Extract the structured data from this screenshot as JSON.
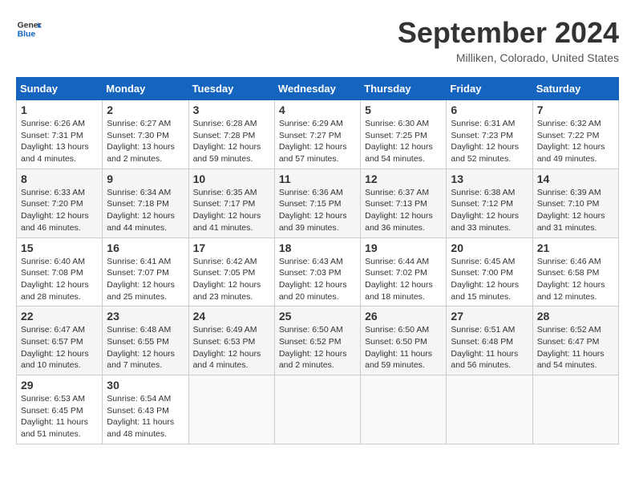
{
  "header": {
    "logo_line1": "General",
    "logo_line2": "Blue",
    "month_title": "September 2024",
    "location": "Milliken, Colorado, United States"
  },
  "weekdays": [
    "Sunday",
    "Monday",
    "Tuesday",
    "Wednesday",
    "Thursday",
    "Friday",
    "Saturday"
  ],
  "weeks": [
    [
      {
        "day": "1",
        "sunrise": "6:26 AM",
        "sunset": "7:31 PM",
        "daylight": "13 hours and 4 minutes"
      },
      {
        "day": "2",
        "sunrise": "6:27 AM",
        "sunset": "7:30 PM",
        "daylight": "13 hours and 2 minutes"
      },
      {
        "day": "3",
        "sunrise": "6:28 AM",
        "sunset": "7:28 PM",
        "daylight": "12 hours and 59 minutes"
      },
      {
        "day": "4",
        "sunrise": "6:29 AM",
        "sunset": "7:27 PM",
        "daylight": "12 hours and 57 minutes"
      },
      {
        "day": "5",
        "sunrise": "6:30 AM",
        "sunset": "7:25 PM",
        "daylight": "12 hours and 54 minutes"
      },
      {
        "day": "6",
        "sunrise": "6:31 AM",
        "sunset": "7:23 PM",
        "daylight": "12 hours and 52 minutes"
      },
      {
        "day": "7",
        "sunrise": "6:32 AM",
        "sunset": "7:22 PM",
        "daylight": "12 hours and 49 minutes"
      }
    ],
    [
      {
        "day": "8",
        "sunrise": "6:33 AM",
        "sunset": "7:20 PM",
        "daylight": "12 hours and 46 minutes"
      },
      {
        "day": "9",
        "sunrise": "6:34 AM",
        "sunset": "7:18 PM",
        "daylight": "12 hours and 44 minutes"
      },
      {
        "day": "10",
        "sunrise": "6:35 AM",
        "sunset": "7:17 PM",
        "daylight": "12 hours and 41 minutes"
      },
      {
        "day": "11",
        "sunrise": "6:36 AM",
        "sunset": "7:15 PM",
        "daylight": "12 hours and 39 minutes"
      },
      {
        "day": "12",
        "sunrise": "6:37 AM",
        "sunset": "7:13 PM",
        "daylight": "12 hours and 36 minutes"
      },
      {
        "day": "13",
        "sunrise": "6:38 AM",
        "sunset": "7:12 PM",
        "daylight": "12 hours and 33 minutes"
      },
      {
        "day": "14",
        "sunrise": "6:39 AM",
        "sunset": "7:10 PM",
        "daylight": "12 hours and 31 minutes"
      }
    ],
    [
      {
        "day": "15",
        "sunrise": "6:40 AM",
        "sunset": "7:08 PM",
        "daylight": "12 hours and 28 minutes"
      },
      {
        "day": "16",
        "sunrise": "6:41 AM",
        "sunset": "7:07 PM",
        "daylight": "12 hours and 25 minutes"
      },
      {
        "day": "17",
        "sunrise": "6:42 AM",
        "sunset": "7:05 PM",
        "daylight": "12 hours and 23 minutes"
      },
      {
        "day": "18",
        "sunrise": "6:43 AM",
        "sunset": "7:03 PM",
        "daylight": "12 hours and 20 minutes"
      },
      {
        "day": "19",
        "sunrise": "6:44 AM",
        "sunset": "7:02 PM",
        "daylight": "12 hours and 18 minutes"
      },
      {
        "day": "20",
        "sunrise": "6:45 AM",
        "sunset": "7:00 PM",
        "daylight": "12 hours and 15 minutes"
      },
      {
        "day": "21",
        "sunrise": "6:46 AM",
        "sunset": "6:58 PM",
        "daylight": "12 hours and 12 minutes"
      }
    ],
    [
      {
        "day": "22",
        "sunrise": "6:47 AM",
        "sunset": "6:57 PM",
        "daylight": "12 hours and 10 minutes"
      },
      {
        "day": "23",
        "sunrise": "6:48 AM",
        "sunset": "6:55 PM",
        "daylight": "12 hours and 7 minutes"
      },
      {
        "day": "24",
        "sunrise": "6:49 AM",
        "sunset": "6:53 PM",
        "daylight": "12 hours and 4 minutes"
      },
      {
        "day": "25",
        "sunrise": "6:50 AM",
        "sunset": "6:52 PM",
        "daylight": "12 hours and 2 minutes"
      },
      {
        "day": "26",
        "sunrise": "6:50 AM",
        "sunset": "6:50 PM",
        "daylight": "11 hours and 59 minutes"
      },
      {
        "day": "27",
        "sunrise": "6:51 AM",
        "sunset": "6:48 PM",
        "daylight": "11 hours and 56 minutes"
      },
      {
        "day": "28",
        "sunrise": "6:52 AM",
        "sunset": "6:47 PM",
        "daylight": "11 hours and 54 minutes"
      }
    ],
    [
      {
        "day": "29",
        "sunrise": "6:53 AM",
        "sunset": "6:45 PM",
        "daylight": "11 hours and 51 minutes"
      },
      {
        "day": "30",
        "sunrise": "6:54 AM",
        "sunset": "6:43 PM",
        "daylight": "11 hours and 48 minutes"
      },
      null,
      null,
      null,
      null,
      null
    ]
  ]
}
